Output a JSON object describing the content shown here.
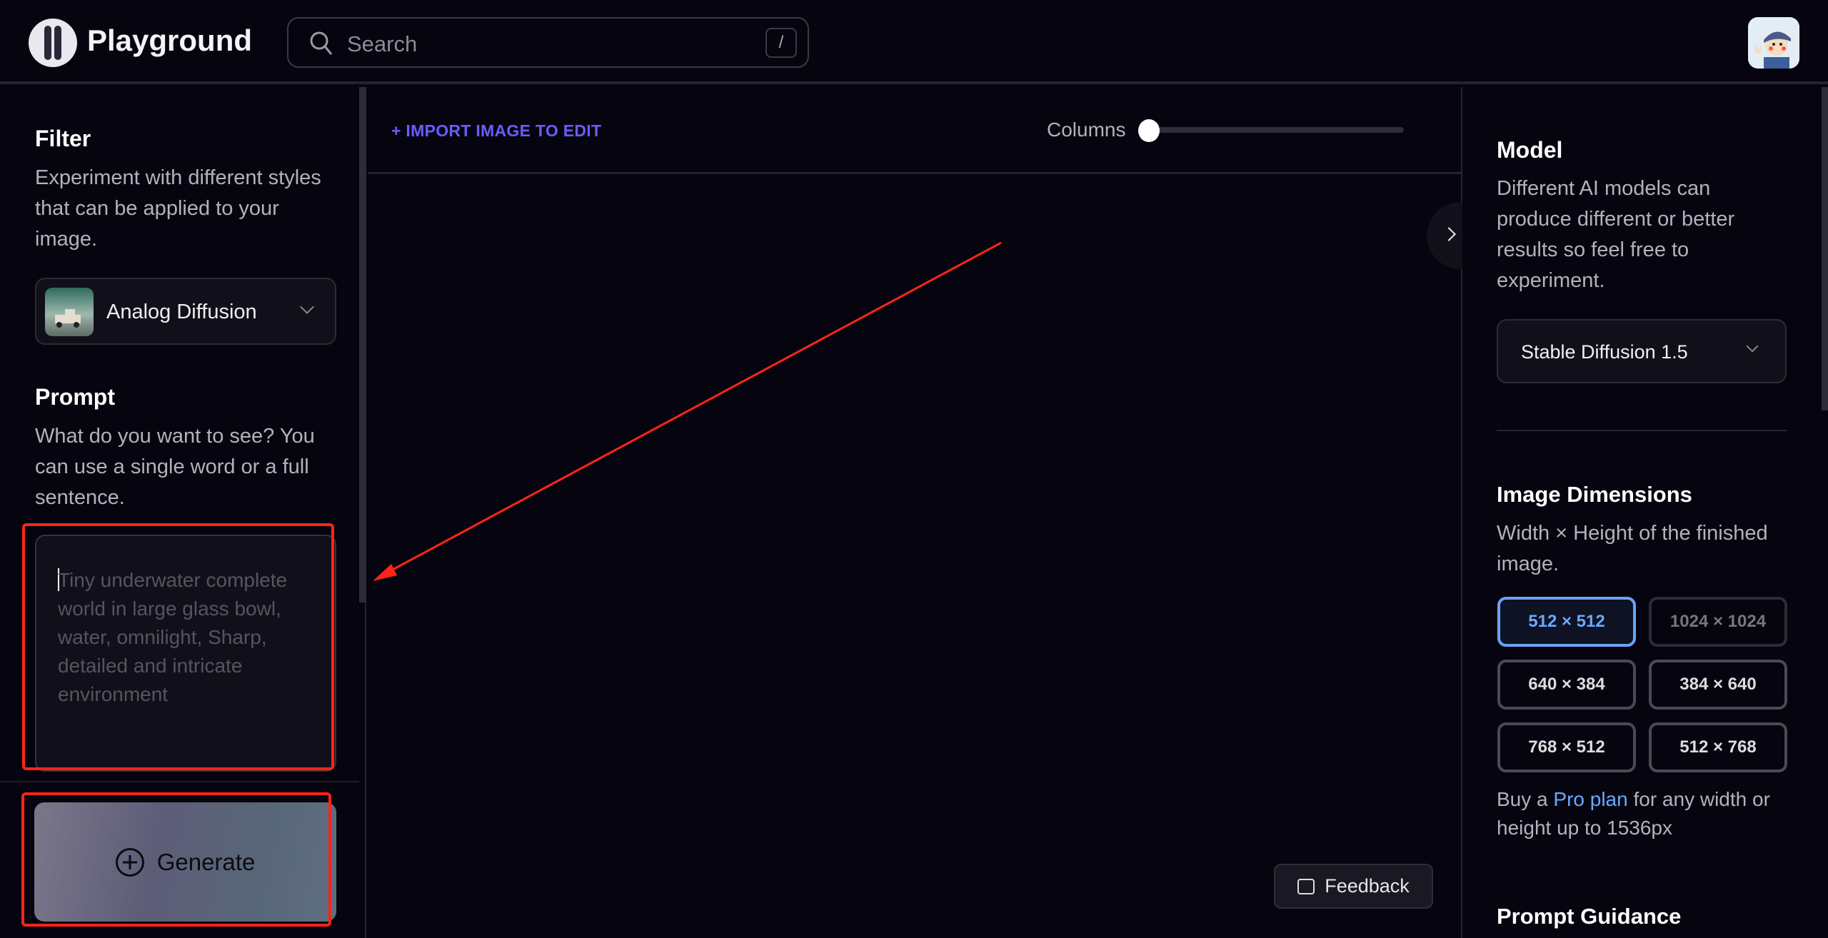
{
  "header": {
    "brand": "Playground",
    "search_placeholder": "Search",
    "search_shortcut": "/"
  },
  "filter": {
    "title": "Filter",
    "description": [
      "Experiment with different styles",
      "that can be applied to your",
      "image."
    ],
    "selected": "Analog Diffusion"
  },
  "prompt": {
    "title": "Prompt",
    "description": [
      "What do you want to see? You",
      "can use a single word or a full",
      "sentence."
    ],
    "placeholder": [
      "Tiny underwater complete",
      "world in large glass bowl,",
      "water, omnilight, Sharp,",
      "detailed and intricate",
      "environment"
    ],
    "value": ""
  },
  "generate_label": "Generate",
  "canvas": {
    "import_label": "+ IMPORT IMAGE TO EDIT",
    "columns_label": "Columns",
    "columns_value_fraction": 0
  },
  "model": {
    "title": "Model",
    "description": [
      "Different AI models can",
      "produce different or better",
      "results so feel free to",
      "experiment."
    ],
    "selected": "Stable Diffusion 1.5"
  },
  "dimensions": {
    "title": "Image Dimensions",
    "description": [
      "Width × Height of the finished",
      "image."
    ],
    "options": [
      {
        "label": "512 × 512",
        "state": "selected"
      },
      {
        "label": "1024 × 1024",
        "state": "disabled"
      },
      {
        "label": "640 × 384",
        "state": "normal"
      },
      {
        "label": "384 × 640",
        "state": "normal"
      },
      {
        "label": "768 × 512",
        "state": "normal"
      },
      {
        "label": "512 × 768",
        "state": "normal"
      }
    ],
    "upsell_prefix": "Buy a ",
    "upsell_link": "Pro plan",
    "upsell_suffix": " for any width or",
    "upsell_line2": "height up to 1536px"
  },
  "prompt_guidance": {
    "title": "Prompt Guidance"
  },
  "feedback_label": "Feedback",
  "colors": {
    "background": "#06050f",
    "accent": "#6a5cff",
    "selected": "#69a3ff",
    "annotation": "#ff2418"
  }
}
